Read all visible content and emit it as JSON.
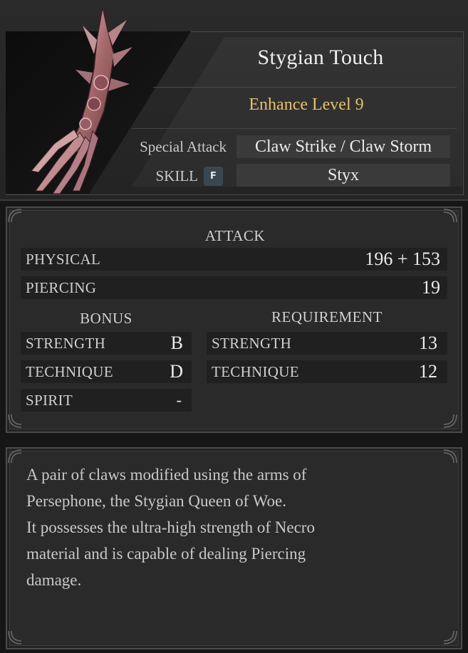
{
  "item": {
    "name": "Stygian Touch",
    "enhance": "Enhance Level 9",
    "special_attack_label": "Special Attack",
    "special_attack_value": "Claw Strike / Claw Storm",
    "skill_label": "SKILL",
    "skill_key": "F",
    "skill_value": "Styx"
  },
  "attack": {
    "heading": "ATTACK",
    "rows": [
      {
        "label": "PHYSICAL",
        "value": "196 + 153"
      },
      {
        "label": "PIERCING",
        "value": "19"
      }
    ]
  },
  "bonus": {
    "heading": "BONUS",
    "rows": [
      {
        "label": "STRENGTH",
        "value": "B"
      },
      {
        "label": "TECHNIQUE",
        "value": "D"
      },
      {
        "label": "SPIRIT",
        "value": "-"
      }
    ]
  },
  "requirement": {
    "heading": "REQUIREMENT",
    "rows": [
      {
        "label": "STRENGTH",
        "value": "13"
      },
      {
        "label": "TECHNIQUE",
        "value": "12"
      }
    ]
  },
  "description": {
    "lines": [
      "A pair of claws modified using the arms of",
      "Persephone, the Stygian Queen of Woe.",
      "It possesses the ultra-high strength of Necro",
      "material and is capable of dealing Piercing",
      "damage."
    ]
  },
  "colors": {
    "enhance": "#e7c06d",
    "skill_key_bg": "#3b4750",
    "claw": "#c89a9a"
  },
  "icons": {
    "weapon": "stygian-claw-icon",
    "corner": "ornate-corner-icon"
  }
}
